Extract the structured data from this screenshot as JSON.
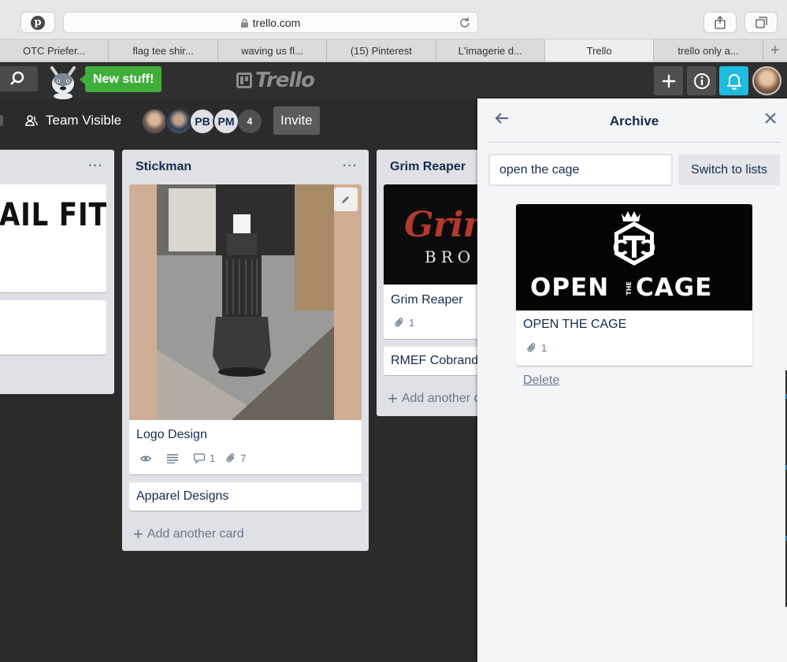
{
  "browser": {
    "url": "trello.com",
    "tabs": [
      {
        "label": "OTC Priefer..."
      },
      {
        "label": "flag tee shir..."
      },
      {
        "label": "waving us fl..."
      },
      {
        "label": "(15) Pinterest"
      },
      {
        "label": "L'imagerie d..."
      },
      {
        "label": "Trello",
        "active": true
      },
      {
        "label": "trello only a..."
      }
    ],
    "new_tab_symbol": "+",
    "icons": [
      "pinterest-icon",
      "lock-icon",
      "reload-icon",
      "share-icon",
      "tabs-overview-icon"
    ]
  },
  "header": {
    "new_stuff_label": "New stuff!",
    "brand": "Trello",
    "icons": [
      "search-icon",
      "add-icon",
      "info-icon",
      "bell-icon"
    ],
    "colors": {
      "bar": "#2f2f2f",
      "new_stuff": "#3eae3a",
      "bell": "#1fbbe0"
    }
  },
  "board_bar": {
    "visibility_label": "Team Visible",
    "members": [
      {
        "type": "photo"
      },
      {
        "type": "photo"
      },
      {
        "type": "initials",
        "label": "PB"
      },
      {
        "type": "initials",
        "label": "PM"
      }
    ],
    "extra_members_count": "4",
    "invite_label": "Invite"
  },
  "lists": [
    {
      "title": "",
      "menu": "···",
      "cards": [
        {
          "cover_text": "AIL FIT"
        },
        {
          "title": ""
        }
      ]
    },
    {
      "title": "Stickman",
      "menu": "···",
      "cards": [
        {
          "title": "Logo Design",
          "comments": "1",
          "attachments": "7",
          "has_description": true,
          "watching": true
        },
        {
          "title": "Apparel Designs"
        }
      ],
      "add_card_label": "Add another card"
    },
    {
      "title": "Grim Reaper",
      "cards": [
        {
          "title": "Grim Reaper",
          "cover_text_top": "Grim",
          "cover_text_bottom": "BRO",
          "attachments": "1"
        },
        {
          "title": "RMEF Cobrand"
        }
      ],
      "add_card_label": "Add another c"
    }
  ],
  "archive_panel": {
    "title": "Archive",
    "search_value": "open the cage",
    "switch_label": "Switch to lists",
    "result_card": {
      "title": "OPEN THE CAGE",
      "attachments": "1",
      "logo_text_left": "OPEN",
      "logo_text_middle": "THE",
      "logo_text_right": "CAGE"
    },
    "delete_label": "Delete"
  }
}
